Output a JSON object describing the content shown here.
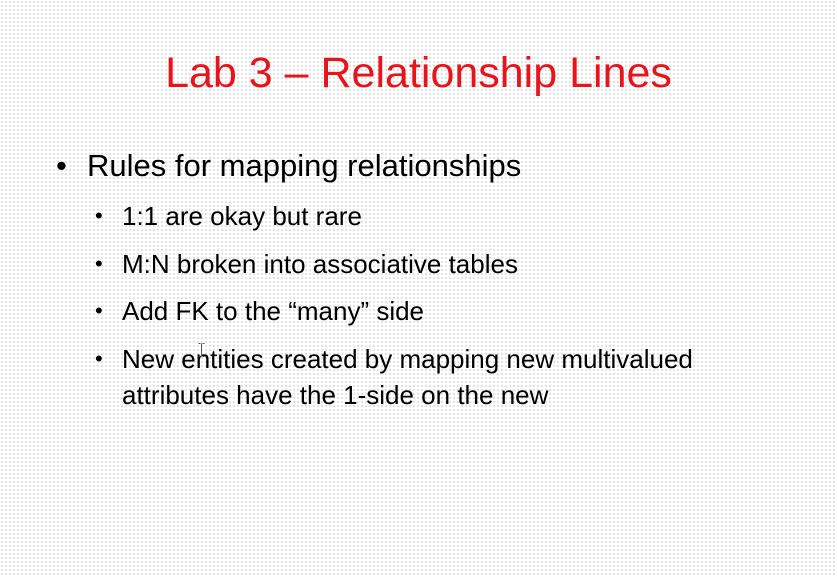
{
  "slide": {
    "title": "Lab 3 – Relationship Lines",
    "title_color": "#e8141c",
    "bullets": [
      {
        "text": "Rules for mapping relationships",
        "sub": [
          "1:1 are okay but rare",
          "M:N broken into associative tables",
          "Add FK to the “many” side",
          "New entities created by mapping new multivalued attributes have the 1-side on the new"
        ]
      }
    ]
  },
  "icons": {
    "bullet": "•",
    "cursor": "text-cursor-icon"
  }
}
